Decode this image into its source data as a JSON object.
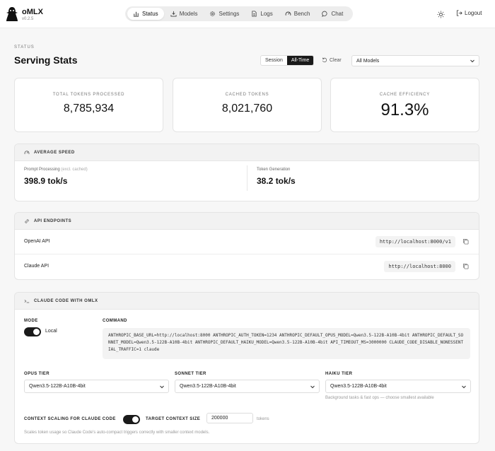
{
  "app": {
    "name": "oMLX",
    "version": "v0.2.5"
  },
  "nav": [
    {
      "label": "Status",
      "icon": "bar-chart-icon",
      "active": true
    },
    {
      "label": "Models",
      "icon": "download-icon",
      "active": false
    },
    {
      "label": "Settings",
      "icon": "gear-icon",
      "active": false
    },
    {
      "label": "Logs",
      "icon": "file-text-icon",
      "active": false
    },
    {
      "label": "Bench",
      "icon": "gauge-icon",
      "active": false
    },
    {
      "label": "Chat",
      "icon": "chat-bubble-icon",
      "active": false
    }
  ],
  "header_actions": {
    "theme_icon": "sun-icon",
    "logout_label": "Logout"
  },
  "status": {
    "section_label": "STATUS",
    "title": "Serving Stats",
    "range": {
      "options": [
        "Session",
        "All-Time"
      ],
      "selected": "All-Time"
    },
    "clear_label": "Clear",
    "model_filter": "All Models"
  },
  "stats": [
    {
      "label": "TOTAL TOKENS PROCESSED",
      "value": "8,785,934"
    },
    {
      "label": "CACHED TOKENS",
      "value": "8,021,760"
    },
    {
      "label": "CACHE EFFICIENCY",
      "value": "91.3%"
    }
  ],
  "speed": {
    "title": "AVERAGE SPEED",
    "prompt_label": "Prompt Processing",
    "prompt_note": "(excl. cached)",
    "prompt_value": "398.9 tok/s",
    "gen_label": "Token Generation",
    "gen_value": "38.2 tok/s"
  },
  "endpoints": {
    "title": "API ENDPOINTS",
    "items": [
      {
        "name": "OpenAI API",
        "url": "http://localhost:8000/v1"
      },
      {
        "name": "Claude API",
        "url": "http://localhost:8000"
      }
    ]
  },
  "claude_code": {
    "title": "CLAUDE CODE WITH OMLX",
    "mode_label": "MODE",
    "mode_value": "Local",
    "command_label": "COMMAND",
    "command": "ANTHROPIC_BASE_URL=http://localhost:8000 ANTHROPIC_AUTH_TOKEN=1234 ANTHROPIC_DEFAULT_OPUS_MODEL=Qwen3.5-122B-A10B-4bit ANTHROPIC_DEFAULT_SONNET_MODEL=Qwen3.5-122B-A10B-4bit ANTHROPIC_DEFAULT_HAIKU_MODEL=Qwen3.5-122B-A10B-4bit API_TIMEOUT_MS=3000000 CLAUDE_CODE_DISABLE_NONESSENTIAL_TRAFFIC=1 claude",
    "tiers": [
      {
        "label": "OPUS TIER",
        "value": "Qwen3.5-122B-A10B-4bit"
      },
      {
        "label": "SONNET TIER",
        "value": "Qwen3.5-122B-A10B-4bit"
      },
      {
        "label": "HAIKU TIER",
        "value": "Qwen3.5-122B-A10B-4bit"
      }
    ],
    "haiku_hint": "Background tasks & fast ops — choose smallest available",
    "context_scaling_label": "CONTEXT SCALING FOR CLAUDE CODE",
    "target_context_label": "TARGET CONTEXT SIZE",
    "target_context_value": "200000",
    "target_context_unit": "tokens",
    "footnote": "Scales token usage so Claude Code's auto-compact triggers correctly with smaller context models."
  }
}
